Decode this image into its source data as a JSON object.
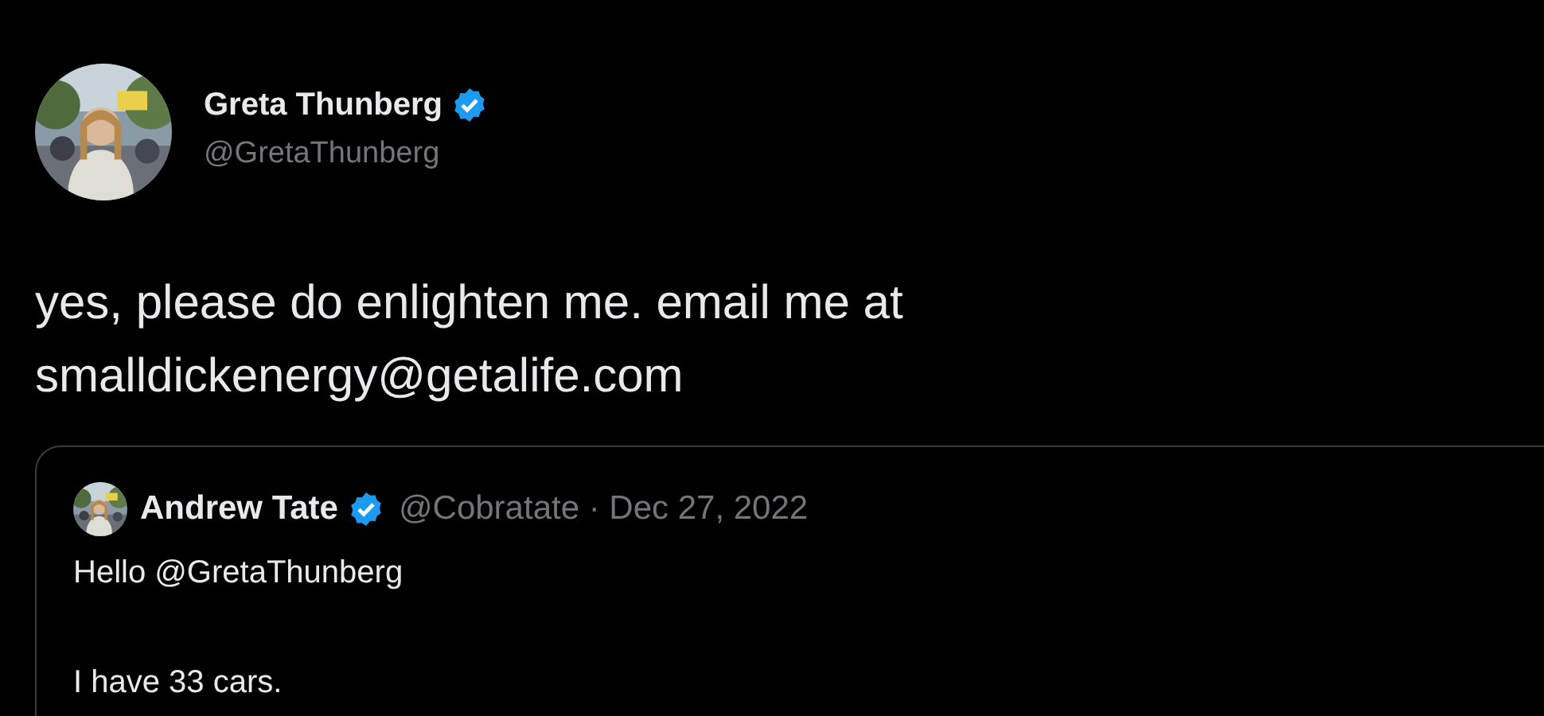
{
  "tweet": {
    "author": {
      "name": "Greta Thunberg",
      "verified": true,
      "handle": "@GretaThunberg"
    },
    "text": "yes, please do enlighten me. email me at smalldickenergy@getalife.com",
    "quote": {
      "author": {
        "name": "Andrew Tate",
        "verified": true
      },
      "byline": "@Cobratate · Dec 27, 2022",
      "paragraphs": [
        "Hello @GretaThunberg",
        "I have 33 cars."
      ]
    }
  }
}
